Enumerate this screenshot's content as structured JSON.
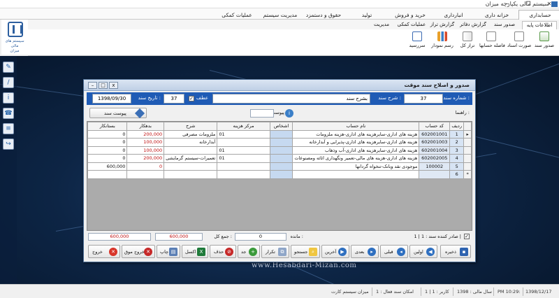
{
  "app": {
    "title": "سیستم مالی یکپارچه میزان"
  },
  "window_buttons": {
    "minimize": "─",
    "restore": "❐",
    "close": "✕"
  },
  "menu": [
    "حسابداری",
    "خزانه داری",
    "انبارداری",
    "خرید و فروش",
    "تولید",
    "حقوق و دستمزد",
    "مدیریت سیستم",
    "عملیات کمکی"
  ],
  "logo": {
    "line1": "سیستم های",
    "line2": "مالی",
    "line3": "میزان"
  },
  "subtabs": [
    "اطلاعات پایه",
    "صدور سند",
    "گزارش دفاتر",
    "گزارش تراز",
    "عملیات کمکی",
    "مدیریت"
  ],
  "ribbon": [
    "صدور سند",
    "صورت اسناد",
    "فاصله حسابها",
    "تراز کل",
    "رسم نمودار",
    "سررسید"
  ],
  "watermark": "www.Hesabdari-Mizan.com",
  "dialog": {
    "title": "صدور و اصلاح سند موقت",
    "doc_number_label": "شماره سند :",
    "doc_number": "37",
    "desc_label": "شرح سند :",
    "desc_value": "بشرح سند",
    "atf_label": "عطف",
    "atf_value": "37",
    "date_label": "تاریخ سند :",
    "date_value": "1398/09/30",
    "guide_label": "راهنما :",
    "attach_label": "از پیوست",
    "attach_button": "پیوست سند"
  },
  "grid": {
    "columns": [
      "ردیف",
      "کد حساب",
      "نام حساب",
      "اشخاص",
      "مرکز هزینه",
      "شرح",
      "بدهکار",
      "بستانکار"
    ],
    "rows": [
      {
        "row": "1",
        "code": "602001001",
        "name": "هزینه های اداری-سایرهزینه های اداری-هزینه ملزومات",
        "person": "",
        "center": "01",
        "desc": "ملزومات مصرفی",
        "debit": "200,000",
        "credit": "0"
      },
      {
        "row": "2",
        "code": "602001003",
        "name": "هزینه های اداری-سایرهزینه های اداری-پذیرایی و آبدارخانه",
        "person": "",
        "center": "",
        "desc": "آبدارخانه",
        "debit": "100,000",
        "credit": "0"
      },
      {
        "row": "3",
        "code": "602001004",
        "name": "هزینه های اداری-سایرهزینه های اداری-آب وذهاب",
        "person": "",
        "center": "01",
        "desc": "",
        "debit": "100,000",
        "credit": "0"
      },
      {
        "row": "4",
        "code": "602002005",
        "name": "هزینه های اداری-هزینه های مالی-تعمیر ونگهداری اثاثه ومصنوعات",
        "person": "",
        "center": "01",
        "desc": "تعمیرات-سیستم گرمایشی",
        "debit": "200,000",
        "credit": "0"
      },
      {
        "row": "5",
        "code": "100002",
        "name": "موجودی نقد وبانک-تنخواه گردانها",
        "person": "",
        "center": "",
        "desc": "",
        "debit": "0",
        "credit": "600,000"
      },
      {
        "row": "6",
        "code": "",
        "name": "",
        "person": "",
        "center": "",
        "desc": "",
        "debit": "",
        "credit": ""
      }
    ]
  },
  "totals": {
    "issuer_label": "صادر کننده سند : 1 | 1 |",
    "balance_label": "مانده :",
    "balance": "0",
    "sum_label": "جمع کل :",
    "sum_debit": "600,000",
    "sum_credit": "600,000"
  },
  "buttons": {
    "save": "ذخیره",
    "first": "اولین",
    "prev": "قبلی",
    "next": "بعدی",
    "last": "آخرین",
    "search": "جستجو",
    "repeat": "تکرار",
    "new": "جد",
    "delete": "حذف",
    "excel": "اکسل",
    "print": "چاپ",
    "temp_exit": "خروج موق",
    "exit": "خروج"
  },
  "status": {
    "cells": [
      "1398/12/17",
      "PM 10:29:",
      "سال مالی : 1398",
      "کاربر : 1 | 1",
      "امکان سند فعال : 1",
      "میزان سیستم کارت"
    ]
  },
  "colors": {
    "header_blue": "#1f5bb5",
    "debit_red": "#c01010",
    "desktop": "#0d2545"
  }
}
